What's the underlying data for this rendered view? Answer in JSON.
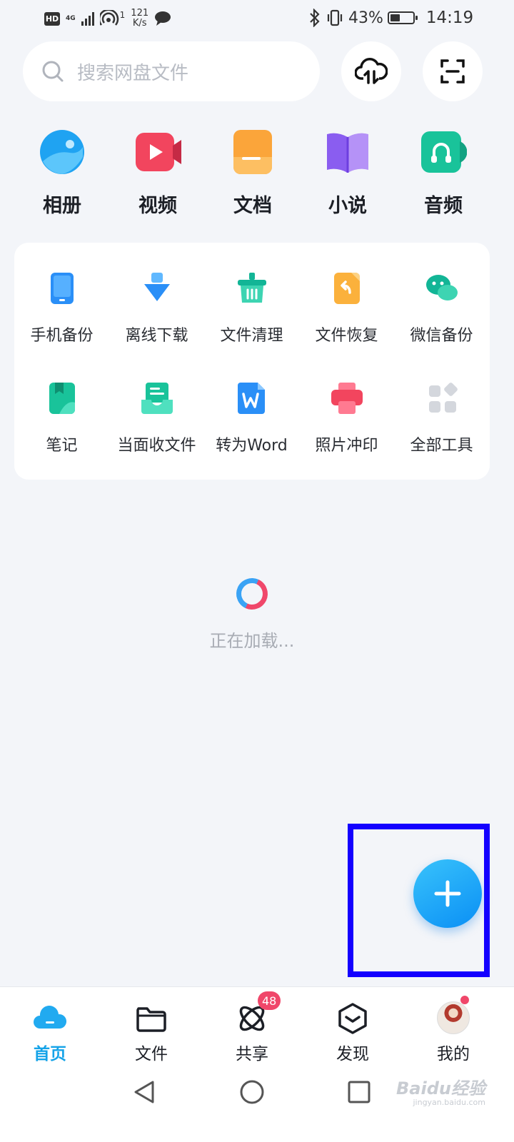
{
  "status_bar": {
    "hd": "HD",
    "network": "4G",
    "hotspot_count": "1",
    "speed_value": "121",
    "speed_unit": "K/s",
    "battery": "43%",
    "battery_level": 0.43,
    "time": "14:19"
  },
  "search": {
    "placeholder": "搜索网盘文件"
  },
  "top_buttons": [
    {
      "icon": "cloud-transfer-icon"
    },
    {
      "icon": "scan-icon"
    }
  ],
  "categories": [
    {
      "label": "相册",
      "icon": "album-icon",
      "color": "#1fa3f2"
    },
    {
      "label": "视频",
      "icon": "video-icon",
      "color": "#f2455e"
    },
    {
      "label": "文档",
      "icon": "document-icon",
      "color": "#fba53a"
    },
    {
      "label": "小说",
      "icon": "novel-icon",
      "color": "#9a6bf0"
    },
    {
      "label": "音频",
      "icon": "audio-icon",
      "color": "#19c39a"
    }
  ],
  "tools": [
    {
      "label": "手机备份",
      "icon": "phone-backup-icon"
    },
    {
      "label": "离线下载",
      "icon": "offline-download-icon"
    },
    {
      "label": "文件清理",
      "icon": "file-cleanup-icon"
    },
    {
      "label": "文件恢复",
      "icon": "file-recovery-icon"
    },
    {
      "label": "微信备份",
      "icon": "wechat-backup-icon"
    },
    {
      "label": "笔记",
      "icon": "notes-icon"
    },
    {
      "label": "当面收文件",
      "icon": "receive-files-icon"
    },
    {
      "label": "转为Word",
      "icon": "convert-word-icon"
    },
    {
      "label": "照片冲印",
      "icon": "photo-print-icon"
    },
    {
      "label": "全部工具",
      "icon": "all-tools-icon"
    }
  ],
  "loading": {
    "text": "正在加载..."
  },
  "fab": {
    "icon": "plus-icon"
  },
  "bottom_nav": [
    {
      "label": "首页",
      "icon": "home-cloud-icon",
      "active": true
    },
    {
      "label": "文件",
      "icon": "folder-icon"
    },
    {
      "label": "共享",
      "icon": "share-icon",
      "badge": "48"
    },
    {
      "label": "发现",
      "icon": "discover-icon"
    },
    {
      "label": "我的",
      "icon": "avatar-icon",
      "dot": true
    }
  ],
  "watermark": {
    "brand": "Baidu经验",
    "url": "jingyan.baidu.com"
  },
  "colors": {
    "accent": "#15a3e8",
    "badge": "#f0476a",
    "highlight": "#1400ff"
  }
}
